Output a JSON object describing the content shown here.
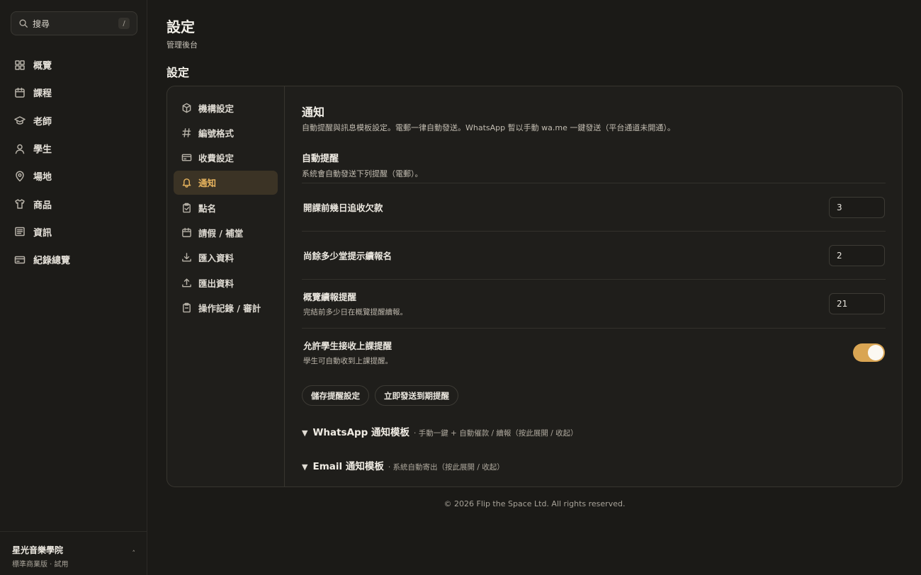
{
  "search": {
    "placeholder": "搜尋",
    "shortcut": "/"
  },
  "sidebar": {
    "items": [
      {
        "label": "概覽",
        "icon": "grid-icon"
      },
      {
        "label": "課程",
        "icon": "calendar-icon"
      },
      {
        "label": "老師",
        "icon": "graduation-cap-icon"
      },
      {
        "label": "學生",
        "icon": "user-icon"
      },
      {
        "label": "場地",
        "icon": "map-pin-icon"
      },
      {
        "label": "商品",
        "icon": "shirt-icon"
      },
      {
        "label": "資訊",
        "icon": "newspaper-icon"
      },
      {
        "label": "紀錄總覽",
        "icon": "credit-card-icon"
      }
    ],
    "org": {
      "name": "星光音樂學院",
      "plan": "標準商業版 · 試用",
      "caret": "˄"
    }
  },
  "header": {
    "title": "設定",
    "subtitle": "管理後台",
    "section": "設定"
  },
  "settings_nav": [
    {
      "label": "機構設定",
      "icon": "box-icon"
    },
    {
      "label": "編號格式",
      "icon": "hash-icon"
    },
    {
      "label": "收費設定",
      "icon": "credit-card-icon"
    },
    {
      "label": "通知",
      "icon": "bell-icon",
      "active": true
    },
    {
      "label": "點名",
      "icon": "clipboard-check-icon"
    },
    {
      "label": "請假 / 補堂",
      "icon": "calendar-icon"
    },
    {
      "label": "匯入資料",
      "icon": "download-icon"
    },
    {
      "label": "匯出資料",
      "icon": "upload-icon"
    },
    {
      "label": "操作記錄 / 審計",
      "icon": "clipboard-icon"
    }
  ],
  "notifications": {
    "title": "通知",
    "description": "自動提醒與訊息模板設定。電郵一律自動發送。WhatsApp 暫以手動 wa.me 一鍵發送（平台通道未開通）。",
    "auto": {
      "title": "自動提醒",
      "description": "系統會自動發送下列提醒（電郵）。"
    },
    "rows": [
      {
        "label": "開課前幾日追收欠款",
        "hint": "",
        "value": "3"
      },
      {
        "label": "尚餘多少堂提示續報名",
        "hint": "",
        "value": "2"
      },
      {
        "label": "概覽續報提醒",
        "hint": "完結前多少日在概覽提醒續報。",
        "value": "21"
      }
    ],
    "toggle_row": {
      "label": "允許學生接收上課提醒",
      "hint": "學生可自動收到上課提醒。",
      "enabled": true
    },
    "buttons": {
      "save": "儲存提醒設定",
      "send_now": "立即發送到期提醒"
    },
    "whatsapp": {
      "arrow": "▼",
      "title": "WhatsApp 通知模板",
      "hint": "· 手動一鍵 + 自動催款 / 續報（按此展開 / 收起）"
    },
    "email": {
      "arrow": "▼",
      "title": "Email 通知模板",
      "hint": "· 系統自動寄出（按此展開 / 收起）"
    }
  },
  "footer": {
    "text": "© 2026 Flip the Space Ltd. All rights reserved."
  },
  "colors": {
    "accent": "#d9a553",
    "active_text": "#e9b55e",
    "background": "#1b1a17"
  }
}
